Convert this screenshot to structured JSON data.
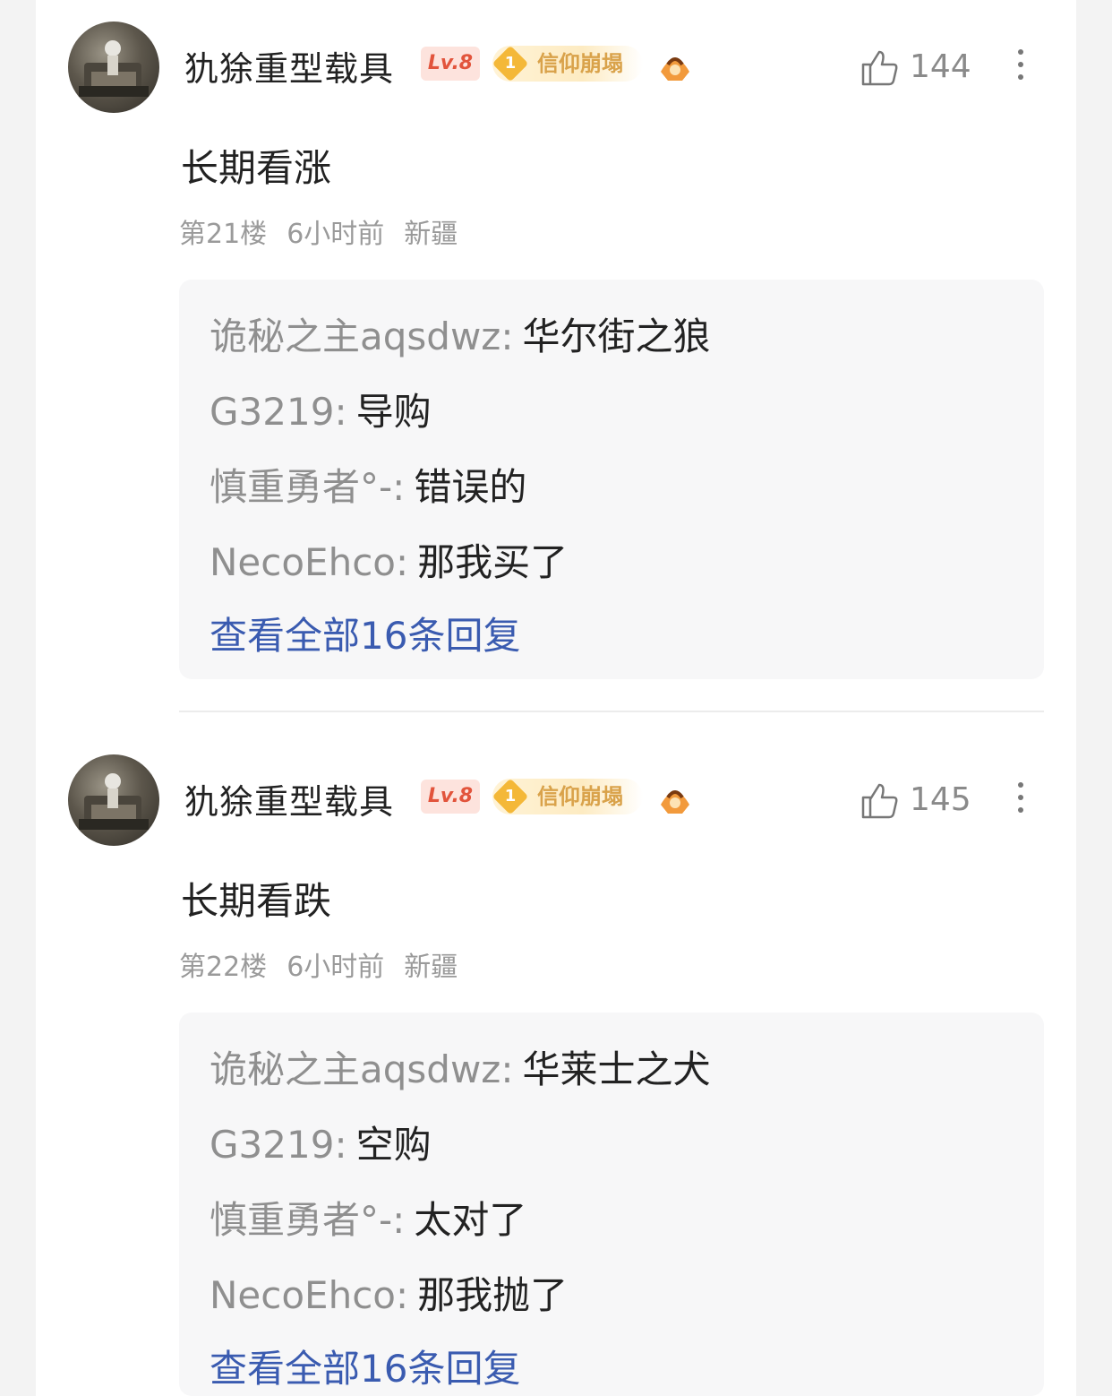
{
  "comments": [
    {
      "username": "犰狳重型载具",
      "level": "Lv.8",
      "badge_num": "1",
      "badge_text": "信仰崩塌",
      "likes": "144",
      "text": "长期看涨",
      "floor": "第21楼",
      "time": "6小时前",
      "location": "新疆",
      "replies": [
        {
          "name": "诡秘之主aqsdwz",
          "text": "华尔街之狼"
        },
        {
          "name": "G3219",
          "text": "导购"
        },
        {
          "name": "慎重勇者°-",
          "text": "错误的"
        },
        {
          "name": "NecoEhco",
          "text": "那我买了"
        }
      ],
      "view_all": "查看全部16条回复"
    },
    {
      "username": "犰狳重型载具",
      "level": "Lv.8",
      "badge_num": "1",
      "badge_text": "信仰崩塌",
      "likes": "145",
      "text": "长期看跌",
      "floor": "第22楼",
      "time": "6小时前",
      "location": "新疆",
      "replies": [
        {
          "name": "诡秘之主aqsdwz",
          "text": "华莱士之犬"
        },
        {
          "name": "G3219",
          "text": "空购"
        },
        {
          "name": "慎重勇者°-",
          "text": "太对了"
        },
        {
          "name": "NecoEhco",
          "text": "那我抛了"
        }
      ],
      "view_all": "查看全部16条回复"
    }
  ],
  "colors": {
    "link": "#3a5bb0",
    "level_badge": "#e2543c",
    "faith_badge": "#f4b838"
  },
  "icons": [
    "avatar",
    "level-badge",
    "faith-badge-icon",
    "medal-icon",
    "thumbs-up-icon",
    "more-vertical-icon"
  ]
}
